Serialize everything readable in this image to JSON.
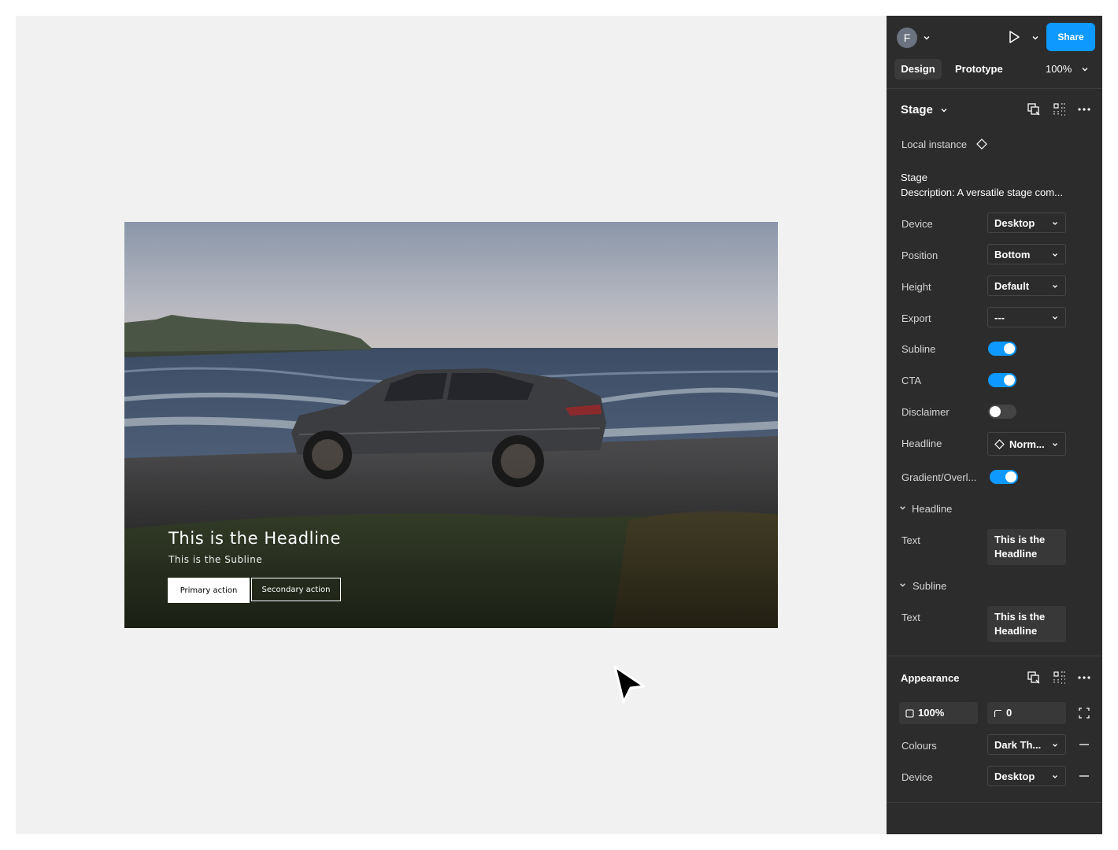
{
  "stage_preview": {
    "headline": "This is the Headline",
    "subline": "This is the Subline",
    "primary_action": "Primary action",
    "secondary_action": "Secondary action"
  },
  "toolbar": {
    "avatar_initial": "F",
    "share_label": "Share",
    "tabs": [
      "Design",
      "Prototype"
    ],
    "zoom": "100%"
  },
  "component": {
    "name": "Stage",
    "instance_label": "Local instance",
    "title": "Stage",
    "description": "Description: A versatile stage com..."
  },
  "properties": {
    "device": {
      "label": "Device",
      "value": "Desktop"
    },
    "position": {
      "label": "Position",
      "value": "Bottom"
    },
    "height": {
      "label": "Height",
      "value": "Default"
    },
    "export": {
      "label": "Export",
      "value": "---"
    },
    "subline": {
      "label": "Subline",
      "on": true
    },
    "cta": {
      "label": "CTA",
      "on": true
    },
    "disclaimer": {
      "label": "Disclaimer",
      "on": false
    },
    "headline": {
      "label": "Headline",
      "value": "Norm..."
    },
    "gradient": {
      "label": "Gradient/Overl...",
      "on": true
    }
  },
  "nested": {
    "headline": {
      "title": "Headline",
      "text_label": "Text",
      "text_value": "This is the Headline"
    },
    "subline": {
      "title": "Subline",
      "text_label": "Text",
      "text_value": "This is the Headline"
    }
  },
  "appearance": {
    "title": "Appearance",
    "opacity": "100%",
    "radius": "0",
    "colours": {
      "label": "Colours",
      "value": "Dark Th..."
    },
    "device": {
      "label": "Device",
      "value": "Desktop"
    }
  },
  "colors": {
    "accent": "#0d99ff",
    "panel_bg": "#2c2c2c",
    "canvas_bg": "#f1f1f1"
  },
  "icons": [
    "chevron-down-icon",
    "play-icon",
    "instance-diamond-icon",
    "go-to-main-icon",
    "detach-icon",
    "more-icon",
    "cursor-icon",
    "opacity-icon",
    "corner-radius-icon",
    "expand-corners-icon",
    "minus-icon"
  ]
}
